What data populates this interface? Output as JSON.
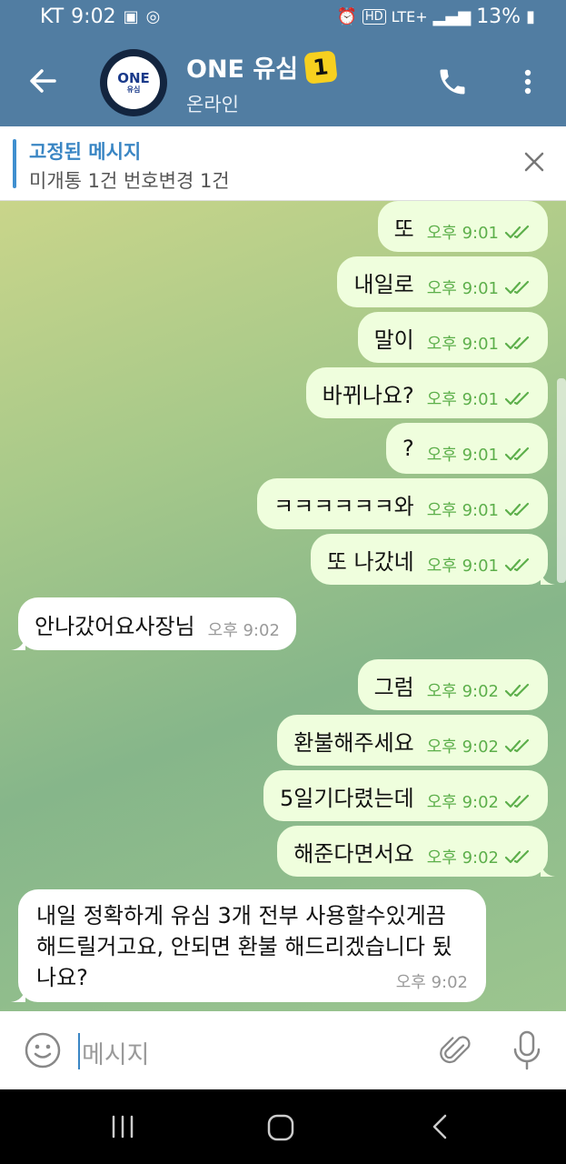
{
  "status_bar": {
    "carrier": "KT",
    "time": "9:02",
    "network": "LTE+",
    "battery": "13%"
  },
  "header": {
    "avatar_text": "ONE",
    "avatar_subtext": "유심",
    "title": "ONE 유심",
    "badge": "1",
    "status": "온라인"
  },
  "pinned": {
    "label": "고정된 메시지",
    "text": "미개통 1건 번호변경 1건"
  },
  "messages": [
    {
      "text": "또",
      "time": "오후 9:01"
    },
    {
      "text": "내일로",
      "time": "오후 9:01"
    },
    {
      "text": "말이",
      "time": "오후 9:01"
    },
    {
      "text": "바뀌나요?",
      "time": "오후 9:01"
    },
    {
      "text": "?",
      "time": "오후 9:01"
    },
    {
      "text": "ㅋㅋㅋㅋㅋㅋ와",
      "time": "오후 9:01"
    },
    {
      "text": "또 나갔네",
      "time": "오후 9:01"
    },
    {
      "text": "안나갔어요사장님",
      "time": "오후 9:02"
    },
    {
      "text": "그럼",
      "time": "오후 9:02"
    },
    {
      "text": "환불해주세요",
      "time": "오후 9:02"
    },
    {
      "text": "5일기다렸는데",
      "time": "오후 9:02"
    },
    {
      "text": "해준다면서요",
      "time": "오후 9:02"
    },
    {
      "text": "내일 정확하게 유심 3개 전부 사용할수있게끔 해드릴거고요, 안되면 환불 해드리겠습니다 됬나요?",
      "time": "오후 9:02"
    }
  ],
  "input": {
    "placeholder": "메시지"
  },
  "colors": {
    "header": "#517DA2",
    "outgoing_bubble": "#EFFEDD",
    "incoming_bubble": "#FFFFFF",
    "accent": "#3A86C4",
    "badge": "#F7D01F"
  }
}
